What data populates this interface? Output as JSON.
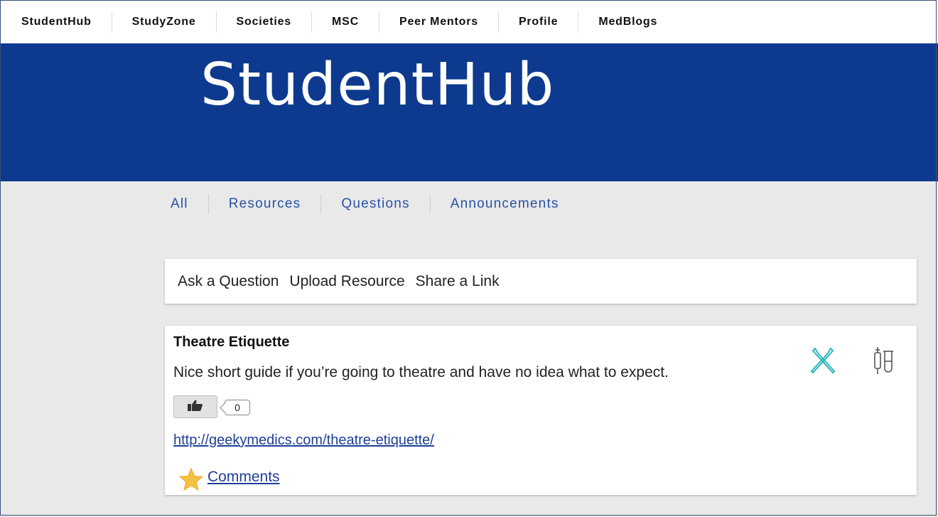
{
  "topnav": {
    "items": [
      "StudentHub",
      "StudyZone",
      "Societies",
      "MSC",
      "Peer Mentors",
      "Profile",
      "MedBlogs"
    ]
  },
  "banner": {
    "logo_text": "StudentHub",
    "bg_color": "#0d3a8e"
  },
  "filters": {
    "tabs": [
      "All",
      "Resources",
      "Questions",
      "Announcements"
    ]
  },
  "actions": {
    "ask": "Ask a Question",
    "upload": "Upload Resource",
    "share": "Share a Link"
  },
  "post": {
    "title": "Theatre Etiquette",
    "description": "Nice short guide if you’re going to theatre and have no idea what to expect.",
    "like_count": "0",
    "link": "http://geekymedics.com/theatre-etiquette/",
    "comments_label": "Comments",
    "icons": [
      "scalpel-icon",
      "test-tubes-icon"
    ]
  }
}
